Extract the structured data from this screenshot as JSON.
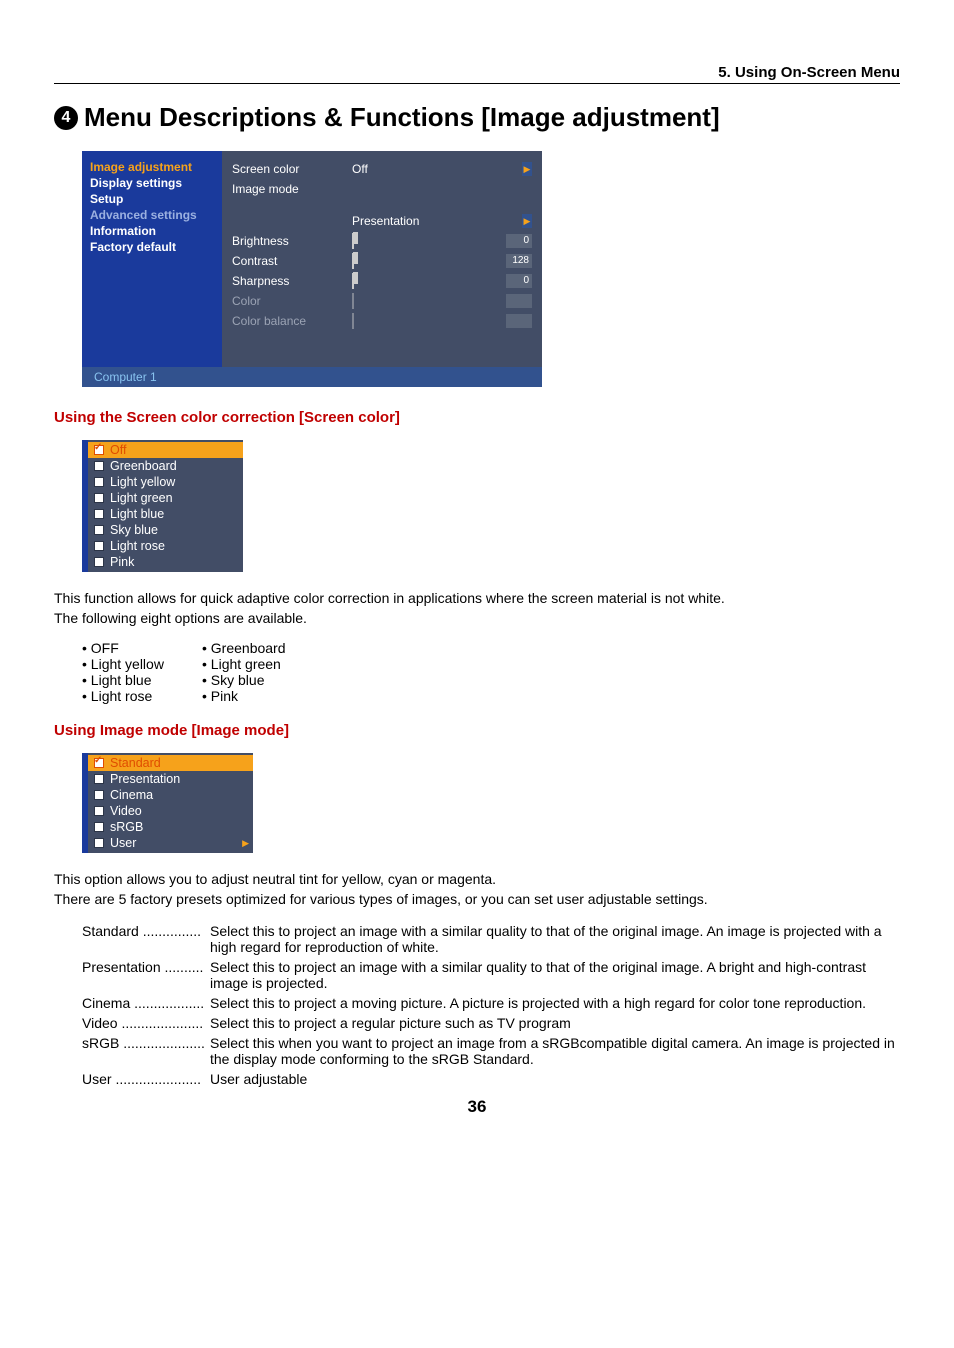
{
  "breadcrumb": "5. Using On-Screen Menu",
  "section_number": "4",
  "title": "Menu Descriptions & Functions [Image adjustment]",
  "osd": {
    "left_menu": [
      {
        "label": "Image adjustment",
        "state": "active"
      },
      {
        "label": "Display settings",
        "state": "normal"
      },
      {
        "label": "Setup",
        "state": "normal"
      },
      {
        "label": "Advanced settings",
        "state": "dim"
      },
      {
        "label": "Information",
        "state": "normal"
      },
      {
        "label": "Factory default",
        "state": "normal"
      }
    ],
    "right_rows": {
      "screen_color": {
        "label": "Screen color",
        "value": "Off"
      },
      "image_mode": {
        "label": "Image mode",
        "value": ""
      },
      "presentation_value": "Presentation",
      "brightness": {
        "label": "Brightness",
        "num": "0"
      },
      "contrast": {
        "label": "Contrast",
        "num": "128"
      },
      "sharpness": {
        "label": "Sharpness",
        "num": "0"
      },
      "color": {
        "label": "Color"
      },
      "color_balance": {
        "label": "Color balance"
      }
    },
    "footer": "Computer 1"
  },
  "section_screen_color": {
    "heading": "Using the Screen color correction [Screen color]",
    "options": [
      "Off",
      "Greenboard",
      "Light yellow",
      "Light green",
      "Light blue",
      "Sky blue",
      "Light rose",
      "Pink"
    ],
    "selected": "Off",
    "para1": "This function allows for quick adaptive color correction in applications where the screen material is not white.",
    "para2": "The following eight options are available.",
    "bullets_col1": [
      "• OFF",
      "• Light yellow",
      "• Light blue",
      "• Light rose"
    ],
    "bullets_col2": [
      "• Greenboard",
      "• Light green",
      "• Sky blue",
      "• Pink"
    ]
  },
  "section_image_mode": {
    "heading": "Using Image mode [Image mode]",
    "options": [
      "Standard",
      "Presentation",
      "Cinema",
      "Video",
      "sRGB",
      "User"
    ],
    "selected": "Standard",
    "has_arrow": "User",
    "para1": "This option allows you to adjust neutral tint for yellow, cyan or magenta.",
    "para2": "There are 5 factory presets optimized for various types of images, or you can set user adjustable settings.",
    "defs": [
      {
        "term": "Standard ...............",
        "desc": "Select this to project an image with a similar quality to that of the original image. An image is projected with a high regard for reproduction of white."
      },
      {
        "term": "Presentation ..........",
        "desc": "Select this to project an image with a similar quality to that of the original image. A bright and high-contrast image is projected."
      },
      {
        "term": "Cinema ..................",
        "desc": "Select this to project a moving picture. A picture is projected with a high regard for color tone reproduction."
      },
      {
        "term": "Video .....................",
        "desc": "Select this to project a regular picture such as TV program"
      },
      {
        "term": "sRGB .....................",
        "desc": "Select this when you want to project an image from a sRGBcompatible digital camera. An image is projected in the display mode conforming to the sRGB Standard."
      },
      {
        "term": "User ......................",
        "desc": "User adjustable"
      }
    ]
  },
  "page_number": "36"
}
